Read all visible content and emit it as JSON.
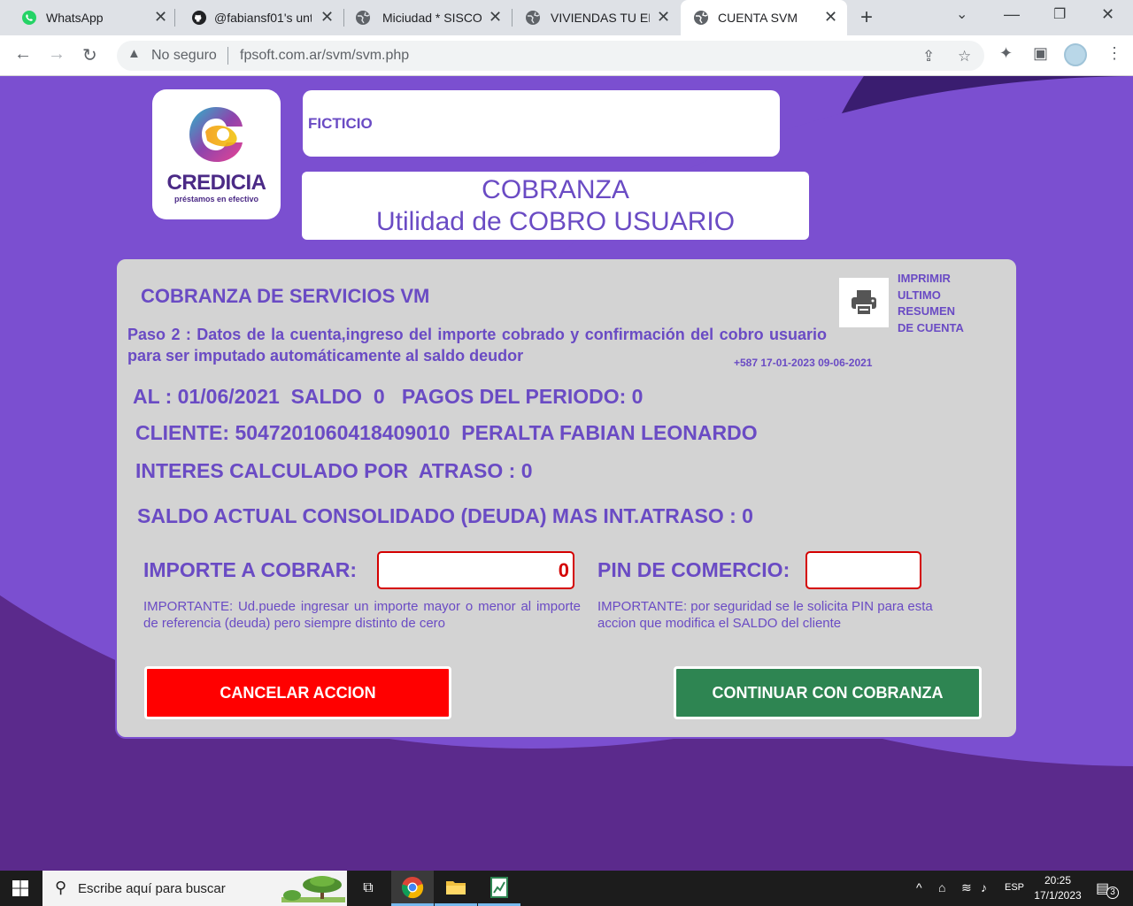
{
  "browser": {
    "tabs": [
      {
        "title": "WhatsApp",
        "icon": "whatsapp-icon",
        "active": false
      },
      {
        "title": "@fabiansf01's unt",
        "icon": "github-icon",
        "active": false
      },
      {
        "title": "Miciudad * SISCO",
        "icon": "globe-icon",
        "active": false
      },
      {
        "title": "VIVIENDAS TU EL",
        "icon": "globe-icon",
        "active": false
      },
      {
        "title": "CUENTA SVM",
        "icon": "globe-icon",
        "active": true
      }
    ],
    "security_label": "No seguro",
    "url_host": "fpsoft.com.ar",
    "url_path": "/svm/svm.php"
  },
  "header": {
    "logo_name": "CREDICIA",
    "logo_tagline": "préstamos en efectivo",
    "account_name": "FICTICIO",
    "title_line1": "COBRANZA",
    "title_line2": "Utilidad de COBRO USUARIO"
  },
  "panel": {
    "title": "COBRANZA DE SERVICIOS VM",
    "step_text": "Paso 2 : Datos de la cuenta,ingreso del importe cobrado y confirmación del cobro usuario para ser imputado automáticamente al saldo deudor",
    "print_label_lines": [
      "IMPRIMIR",
      "ULTIMO",
      "RESUMEN",
      "DE CUENTA"
    ],
    "stamp": "+587  17-01-2023 09-06-2021",
    "summary_line": "AL : 01/06/2021  SALDO  0   PAGOS DEL PERIODO: 0",
    "client_line": "CLIENTE: 5047201060418409010  PERALTA FABIAN LEONARDO",
    "interest_line": "INTERES CALCULADO POR  ATRASO : 0",
    "balance_line": "SALDO ACTUAL CONSOLIDADO (DEUDA) MAS INT.ATRASO : 0",
    "amount_label": "IMPORTE A COBRAR:",
    "amount_value": "0",
    "pin_label": "PIN DE COMERCIO:",
    "pin_value": "",
    "amount_note": "IMPORTANTE: Ud.puede ingresar un importe mayor o menor al importe de referencia (deuda) pero siempre distinto de cero",
    "pin_note": "IMPORTANTE: por seguridad se le solicita PIN para esta accion que modifica el SALDO del cliente",
    "cancel_label": "CANCELAR ACCION",
    "continue_label": "CONTINUAR CON COBRANZA"
  },
  "taskbar": {
    "search_placeholder": "Escribe aquí para buscar",
    "language": "ESP",
    "time": "20:25",
    "date": "17/1/2023",
    "notification_count": "3"
  },
  "colors": {
    "accent": "#6a4bc4",
    "page_bg": "#7b4fd0",
    "cancel": "#ff0000",
    "continue": "#2e8552",
    "input_border": "#d40000"
  }
}
